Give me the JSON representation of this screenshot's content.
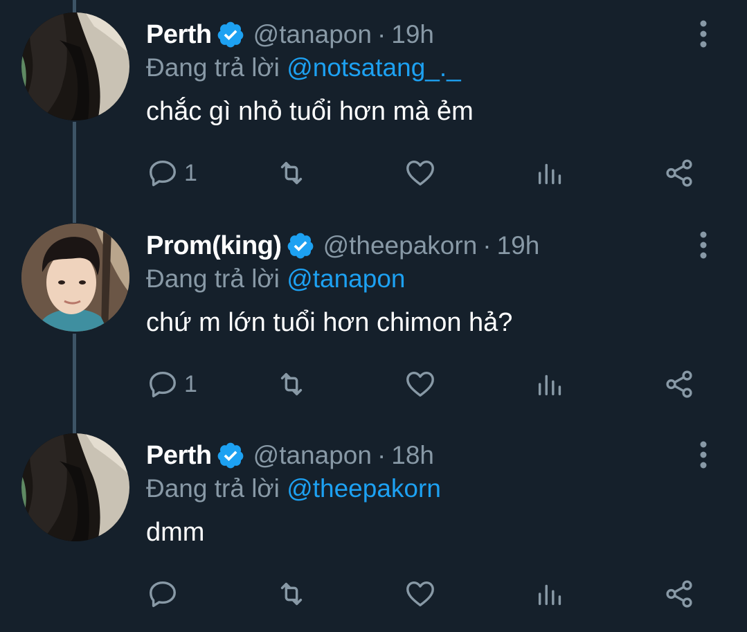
{
  "colors": {
    "background": "#15202b",
    "name": "#ffffff",
    "secondary": "#8899a6",
    "mention": "#1da1f2",
    "verified": "#1da1f2",
    "thread_line": "#3d5466"
  },
  "reply_prefix": "Đang trả lời",
  "separator": "·",
  "tweets": [
    {
      "name": "Perth",
      "handle": "@tanapon",
      "time": "19h",
      "reply_to": "@notsatang_._",
      "text": "chắc gì nhỏ tuổi hơn mà ẻm",
      "reply_count": "1",
      "verified": true
    },
    {
      "name": "Prom(king)",
      "handle": "@theepakorn",
      "time": "19h",
      "reply_to": "@tanapon",
      "text": "chứ m lớn tuổi hơn chimon hả?",
      "reply_count": "1",
      "verified": true
    },
    {
      "name": "Perth",
      "handle": "@tanapon",
      "time": "18h",
      "reply_to": "@theepakorn",
      "text": "dmm",
      "reply_count": "",
      "verified": true
    }
  ],
  "icons": {
    "reply": "reply-icon",
    "retweet": "retweet-icon",
    "like": "heart-icon",
    "analytics": "analytics-icon",
    "share": "share-icon",
    "more": "more-vertical-icon",
    "verified": "verified-badge-icon"
  }
}
